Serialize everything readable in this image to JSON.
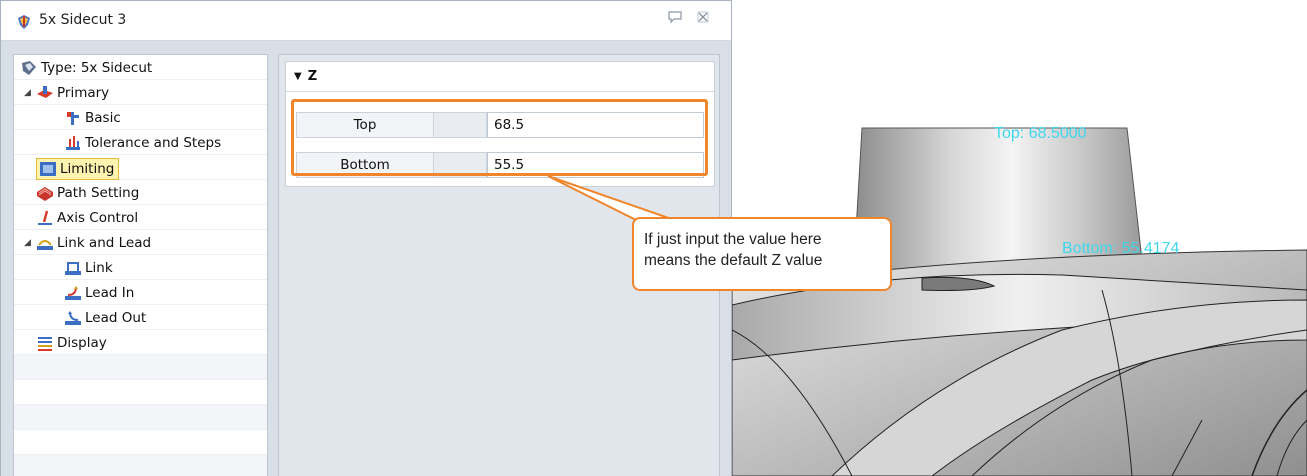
{
  "window": {
    "title": "5x Sidecut 3",
    "title_icon": "5x-sidecut-icon",
    "pin_icon": "pin-icon",
    "close_icon": "close-icon"
  },
  "tree": {
    "items": [
      {
        "label": "Type: 5x Sidecut",
        "icon": "sidecut-type-icon"
      },
      {
        "label": "Primary",
        "icon": "primary-icon"
      },
      {
        "label": "Basic",
        "icon": "basic-icon"
      },
      {
        "label": "Tolerance and Steps",
        "icon": "tolerance-steps-icon"
      },
      {
        "label": "Limiting",
        "icon": "limiting-icon"
      },
      {
        "label": "Path Setting",
        "icon": "path-setting-icon"
      },
      {
        "label": "Axis Control",
        "icon": "axis-control-icon"
      },
      {
        "label": "Link and Lead",
        "icon": "link-lead-icon"
      },
      {
        "label": "Link",
        "icon": "link-icon"
      },
      {
        "label": "Lead In",
        "icon": "lead-in-icon"
      },
      {
        "label": "Lead Out",
        "icon": "lead-out-icon"
      },
      {
        "label": "Display",
        "icon": "display-icon"
      }
    ],
    "selected": "Limiting"
  },
  "props": {
    "section_title": "Z",
    "rows": [
      {
        "label": "Top",
        "value": "68.5"
      },
      {
        "label": "Bottom",
        "value": "55.5"
      }
    ]
  },
  "callout": {
    "line1": "If just input the value here",
    "line2": "means the default Z value"
  },
  "viewport": {
    "top_label": "Top: 68.5000",
    "bottom_label": "Bottom: 55.4174"
  },
  "colors": {
    "highlight": "#f0852b",
    "dimension": "#3fd7ec",
    "selection": "#fff3b0"
  }
}
